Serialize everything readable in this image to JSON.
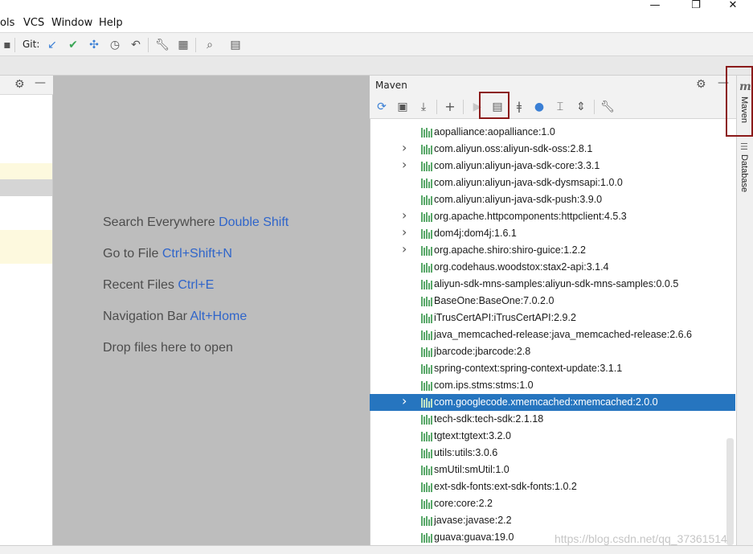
{
  "menu": {
    "items": [
      "ols",
      "VCS",
      "Window",
      "Help"
    ]
  },
  "window_controls": {
    "minimize": "—",
    "restore": "❐",
    "close": "✕"
  },
  "toolbar": {
    "git_label": "Git:"
  },
  "editor_hints": [
    {
      "text": "Search Everywhere",
      "shortcut": "Double Shift"
    },
    {
      "text": "Go to File",
      "shortcut": "Ctrl+Shift+N"
    },
    {
      "text": "Recent Files",
      "shortcut": "Ctrl+E"
    },
    {
      "text": "Navigation Bar",
      "shortcut": "Alt+Home"
    },
    {
      "text": "Drop files here to open",
      "shortcut": ""
    }
  ],
  "maven": {
    "title": "Maven",
    "dependencies": [
      {
        "label": "aopalliance:aopalliance:1.0",
        "expandable": false,
        "selected": false
      },
      {
        "label": "com.aliyun.oss:aliyun-sdk-oss:2.8.1",
        "expandable": true,
        "selected": false
      },
      {
        "label": "com.aliyun:aliyun-java-sdk-core:3.3.1",
        "expandable": true,
        "selected": false
      },
      {
        "label": "com.aliyun:aliyun-java-sdk-dysmsapi:1.0.0",
        "expandable": false,
        "selected": false
      },
      {
        "label": "com.aliyun:aliyun-java-sdk-push:3.9.0",
        "expandable": false,
        "selected": false
      },
      {
        "label": "org.apache.httpcomponents:httpclient:4.5.3",
        "expandable": true,
        "selected": false
      },
      {
        "label": "dom4j:dom4j:1.6.1",
        "expandable": true,
        "selected": false
      },
      {
        "label": "org.apache.shiro:shiro-guice:1.2.2",
        "expandable": true,
        "selected": false
      },
      {
        "label": "org.codehaus.woodstox:stax2-api:3.1.4",
        "expandable": false,
        "selected": false
      },
      {
        "label": "aliyun-sdk-mns-samples:aliyun-sdk-mns-samples:0.0.5",
        "expandable": false,
        "selected": false
      },
      {
        "label": "BaseOne:BaseOne:7.0.2.0",
        "expandable": false,
        "selected": false
      },
      {
        "label": "iTrusCertAPI:iTrusCertAPI:2.9.2",
        "expandable": false,
        "selected": false
      },
      {
        "label": "java_memcached-release:java_memcached-release:2.6.6",
        "expandable": false,
        "selected": false
      },
      {
        "label": "jbarcode:jbarcode:2.8",
        "expandable": false,
        "selected": false
      },
      {
        "label": "spring-context:spring-context-update:3.1.1",
        "expandable": false,
        "selected": false
      },
      {
        "label": "com.ips.stms:stms:1.0",
        "expandable": false,
        "selected": false
      },
      {
        "label": "com.googlecode.xmemcached:xmemcached:2.0.0",
        "expandable": true,
        "selected": true
      },
      {
        "label": "tech-sdk:tech-sdk:2.1.18",
        "expandable": false,
        "selected": false
      },
      {
        "label": "tgtext:tgtext:3.2.0",
        "expandable": false,
        "selected": false
      },
      {
        "label": "utils:utils:3.0.6",
        "expandable": false,
        "selected": false
      },
      {
        "label": "smUtil:smUtil:1.0",
        "expandable": false,
        "selected": false
      },
      {
        "label": "ext-sdk-fonts:ext-sdk-fonts:1.0.2",
        "expandable": false,
        "selected": false
      },
      {
        "label": "core:core:2.2",
        "expandable": false,
        "selected": false
      },
      {
        "label": "javase:javase:2.2",
        "expandable": false,
        "selected": false
      },
      {
        "label": "guava:guava:19.0",
        "expandable": false,
        "selected": false
      }
    ]
  },
  "right_strip": {
    "maven_tab": "Maven",
    "database_tab": "Database"
  },
  "watermark": "https://blog.csdn.net/qq_37361514",
  "colors": {
    "selection": "#2675bf",
    "shortcut": "#2f65ca",
    "library_icon": "#59a869",
    "highlight": "#8b1a1a"
  }
}
